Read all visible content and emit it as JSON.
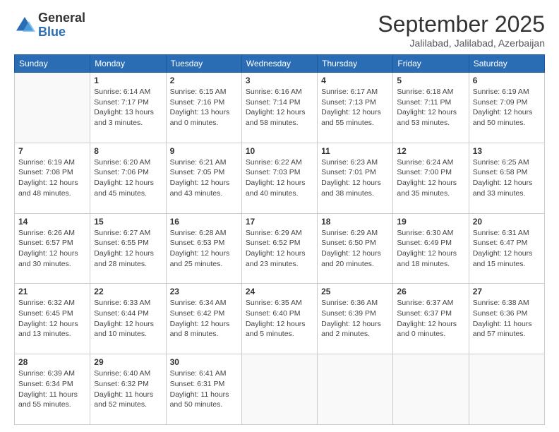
{
  "logo": {
    "general": "General",
    "blue": "Blue"
  },
  "header": {
    "month": "September 2025",
    "location": "Jalilabad, Jalilabad, Azerbaijan"
  },
  "weekdays": [
    "Sunday",
    "Monday",
    "Tuesday",
    "Wednesday",
    "Thursday",
    "Friday",
    "Saturday"
  ],
  "weeks": [
    [
      {
        "day": "",
        "info": ""
      },
      {
        "day": "1",
        "info": "Sunrise: 6:14 AM\nSunset: 7:17 PM\nDaylight: 13 hours\nand 3 minutes."
      },
      {
        "day": "2",
        "info": "Sunrise: 6:15 AM\nSunset: 7:16 PM\nDaylight: 13 hours\nand 0 minutes."
      },
      {
        "day": "3",
        "info": "Sunrise: 6:16 AM\nSunset: 7:14 PM\nDaylight: 12 hours\nand 58 minutes."
      },
      {
        "day": "4",
        "info": "Sunrise: 6:17 AM\nSunset: 7:13 PM\nDaylight: 12 hours\nand 55 minutes."
      },
      {
        "day": "5",
        "info": "Sunrise: 6:18 AM\nSunset: 7:11 PM\nDaylight: 12 hours\nand 53 minutes."
      },
      {
        "day": "6",
        "info": "Sunrise: 6:19 AM\nSunset: 7:09 PM\nDaylight: 12 hours\nand 50 minutes."
      }
    ],
    [
      {
        "day": "7",
        "info": "Sunrise: 6:19 AM\nSunset: 7:08 PM\nDaylight: 12 hours\nand 48 minutes."
      },
      {
        "day": "8",
        "info": "Sunrise: 6:20 AM\nSunset: 7:06 PM\nDaylight: 12 hours\nand 45 minutes."
      },
      {
        "day": "9",
        "info": "Sunrise: 6:21 AM\nSunset: 7:05 PM\nDaylight: 12 hours\nand 43 minutes."
      },
      {
        "day": "10",
        "info": "Sunrise: 6:22 AM\nSunset: 7:03 PM\nDaylight: 12 hours\nand 40 minutes."
      },
      {
        "day": "11",
        "info": "Sunrise: 6:23 AM\nSunset: 7:01 PM\nDaylight: 12 hours\nand 38 minutes."
      },
      {
        "day": "12",
        "info": "Sunrise: 6:24 AM\nSunset: 7:00 PM\nDaylight: 12 hours\nand 35 minutes."
      },
      {
        "day": "13",
        "info": "Sunrise: 6:25 AM\nSunset: 6:58 PM\nDaylight: 12 hours\nand 33 minutes."
      }
    ],
    [
      {
        "day": "14",
        "info": "Sunrise: 6:26 AM\nSunset: 6:57 PM\nDaylight: 12 hours\nand 30 minutes."
      },
      {
        "day": "15",
        "info": "Sunrise: 6:27 AM\nSunset: 6:55 PM\nDaylight: 12 hours\nand 28 minutes."
      },
      {
        "day": "16",
        "info": "Sunrise: 6:28 AM\nSunset: 6:53 PM\nDaylight: 12 hours\nand 25 minutes."
      },
      {
        "day": "17",
        "info": "Sunrise: 6:29 AM\nSunset: 6:52 PM\nDaylight: 12 hours\nand 23 minutes."
      },
      {
        "day": "18",
        "info": "Sunrise: 6:29 AM\nSunset: 6:50 PM\nDaylight: 12 hours\nand 20 minutes."
      },
      {
        "day": "19",
        "info": "Sunrise: 6:30 AM\nSunset: 6:49 PM\nDaylight: 12 hours\nand 18 minutes."
      },
      {
        "day": "20",
        "info": "Sunrise: 6:31 AM\nSunset: 6:47 PM\nDaylight: 12 hours\nand 15 minutes."
      }
    ],
    [
      {
        "day": "21",
        "info": "Sunrise: 6:32 AM\nSunset: 6:45 PM\nDaylight: 12 hours\nand 13 minutes."
      },
      {
        "day": "22",
        "info": "Sunrise: 6:33 AM\nSunset: 6:44 PM\nDaylight: 12 hours\nand 10 minutes."
      },
      {
        "day": "23",
        "info": "Sunrise: 6:34 AM\nSunset: 6:42 PM\nDaylight: 12 hours\nand 8 minutes."
      },
      {
        "day": "24",
        "info": "Sunrise: 6:35 AM\nSunset: 6:40 PM\nDaylight: 12 hours\nand 5 minutes."
      },
      {
        "day": "25",
        "info": "Sunrise: 6:36 AM\nSunset: 6:39 PM\nDaylight: 12 hours\nand 2 minutes."
      },
      {
        "day": "26",
        "info": "Sunrise: 6:37 AM\nSunset: 6:37 PM\nDaylight: 12 hours\nand 0 minutes."
      },
      {
        "day": "27",
        "info": "Sunrise: 6:38 AM\nSunset: 6:36 PM\nDaylight: 11 hours\nand 57 minutes."
      }
    ],
    [
      {
        "day": "28",
        "info": "Sunrise: 6:39 AM\nSunset: 6:34 PM\nDaylight: 11 hours\nand 55 minutes."
      },
      {
        "day": "29",
        "info": "Sunrise: 6:40 AM\nSunset: 6:32 PM\nDaylight: 11 hours\nand 52 minutes."
      },
      {
        "day": "30",
        "info": "Sunrise: 6:41 AM\nSunset: 6:31 PM\nDaylight: 11 hours\nand 50 minutes."
      },
      {
        "day": "",
        "info": ""
      },
      {
        "day": "",
        "info": ""
      },
      {
        "day": "",
        "info": ""
      },
      {
        "day": "",
        "info": ""
      }
    ]
  ]
}
